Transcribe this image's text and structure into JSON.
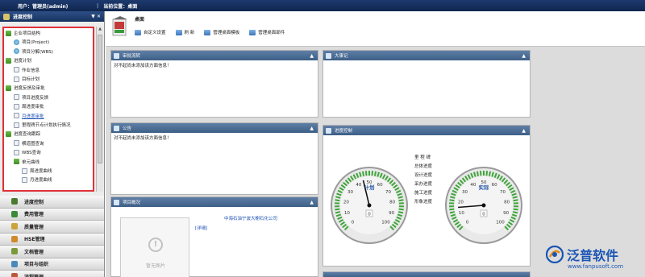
{
  "topbar": {
    "user": "用户：管理员(admin)",
    "separator": "|",
    "location": "当前位置：桌面"
  },
  "sidebar": {
    "title": "进度控制",
    "pin": "▼ ✕",
    "tree": [
      {
        "label": "企业项目结构",
        "icon": "folder-icon"
      },
      {
        "label": "项目(Project)",
        "icon": "globe-icon"
      },
      {
        "label": "项目分解(WBS)",
        "icon": "globe-icon"
      },
      {
        "label": "进度计划",
        "icon": "folder-icon"
      },
      {
        "label": "作业信息",
        "icon": "doc-icon"
      },
      {
        "label": "目标计划",
        "icon": "doc-icon"
      },
      {
        "label": "进度反馈及审批",
        "icon": "folder-icon"
      },
      {
        "label": "项目进度反馈",
        "icon": "doc-icon"
      },
      {
        "label": "周进度审批",
        "icon": "doc-icon"
      },
      {
        "label": "月进度审批",
        "icon": "doc-icon"
      },
      {
        "label": "里程碑节点计划执行情况",
        "icon": "doc-icon"
      },
      {
        "label": "进度查询跟踪",
        "icon": "folder-icon"
      },
      {
        "label": "横道图查询",
        "icon": "doc-icon"
      },
      {
        "label": "WBS查询",
        "icon": "doc-icon"
      },
      {
        "label": "单元曲线",
        "icon": "folder-icon"
      },
      {
        "label": "周进度曲线",
        "icon": "doc-icon"
      },
      {
        "label": "月进度曲线",
        "icon": "doc-icon"
      }
    ],
    "nav": [
      {
        "label": "进度控制",
        "color": "#4a7a2f"
      },
      {
        "label": "费用管理",
        "color": "#3a8a3a"
      },
      {
        "label": "质量管理",
        "color": "#c8a43a"
      },
      {
        "label": "HSE管理",
        "color": "#d08a2a"
      },
      {
        "label": "文档管理",
        "color": "#7a9a3a"
      },
      {
        "label": "项目与组织",
        "color": "#4a8ab8"
      },
      {
        "label": "流程管理",
        "color": "#b85a3a"
      }
    ]
  },
  "toolbar": {
    "title": "桌面",
    "actions": [
      {
        "label": "自定义设置",
        "icon": "settings-icon"
      },
      {
        "label": "刷 新",
        "icon": "refresh-icon"
      },
      {
        "label": "管理桌面模板",
        "icon": "template-icon"
      },
      {
        "label": "管理桌面部件",
        "icon": "widget-icon"
      }
    ]
  },
  "panels": {
    "approval": {
      "title": "审批流转",
      "body": "对不起尚未添加该方面信息！",
      "collapse": "▲"
    },
    "events": {
      "title": "大事记",
      "collapse": "▲"
    },
    "notice": {
      "title": "公告",
      "body": "对不起尚未添加该方面信息！",
      "collapse": "▲"
    },
    "overview": {
      "title": "项目概况",
      "company": "中海石油宁波大榭石化公司",
      "detail": "[详细]",
      "nophoto": "暂无图片",
      "collapse": "▲"
    },
    "progress": {
      "title": "进度控制",
      "collapse": "▲"
    }
  },
  "gauges": [
    {
      "label": "计划",
      "value": 45,
      "center": "0",
      "ticks": [
        "0",
        "10",
        "20",
        "30",
        "40",
        "50",
        "60",
        "70",
        "80",
        "90",
        "100"
      ]
    },
    {
      "label": "实际",
      "value": 15,
      "center": "0",
      "ticks": [
        "0",
        "10",
        "20",
        "30",
        "40",
        "50",
        "60",
        "70",
        "80",
        "90",
        "100"
      ]
    }
  ],
  "gauge_legend": [
    "里 程 碑",
    "总体进度",
    "设计进度",
    "采办进度",
    "施工进度",
    "形象进度"
  ],
  "logo": {
    "text": "泛普软件",
    "url": "www.fanpusoft.com",
    "color": "#1a55b5"
  }
}
